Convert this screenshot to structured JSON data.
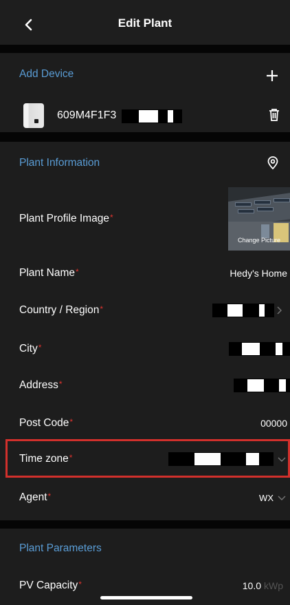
{
  "header": {
    "title": "Edit Plant"
  },
  "device_section": {
    "title": "Add Device",
    "device": {
      "serial": "609M4F1F3"
    }
  },
  "plant_info": {
    "title": "Plant Information",
    "profile_image_label": "Plant Profile Image",
    "change_picture_label": "Change Picture",
    "fields": {
      "plant_name": {
        "label": "Plant Name",
        "value": "Hedy's Home"
      },
      "country": {
        "label": "Country / Region"
      },
      "city": {
        "label": "City"
      },
      "address": {
        "label": "Address"
      },
      "post_code": {
        "label": "Post Code",
        "value": "00000"
      },
      "time_zone": {
        "label": "Time zone"
      },
      "agent": {
        "label": "Agent",
        "value": "WX"
      }
    }
  },
  "plant_params": {
    "title": "Plant Parameters",
    "pv_capacity": {
      "label": "PV Capacity",
      "value": "10.0",
      "unit": "kWp"
    }
  },
  "required_mark": "*",
  "colors": {
    "accent": "#5a9dd6",
    "required": "#e0342f",
    "highlight": "#d2302c",
    "section_bg": "#1d1d1d"
  }
}
